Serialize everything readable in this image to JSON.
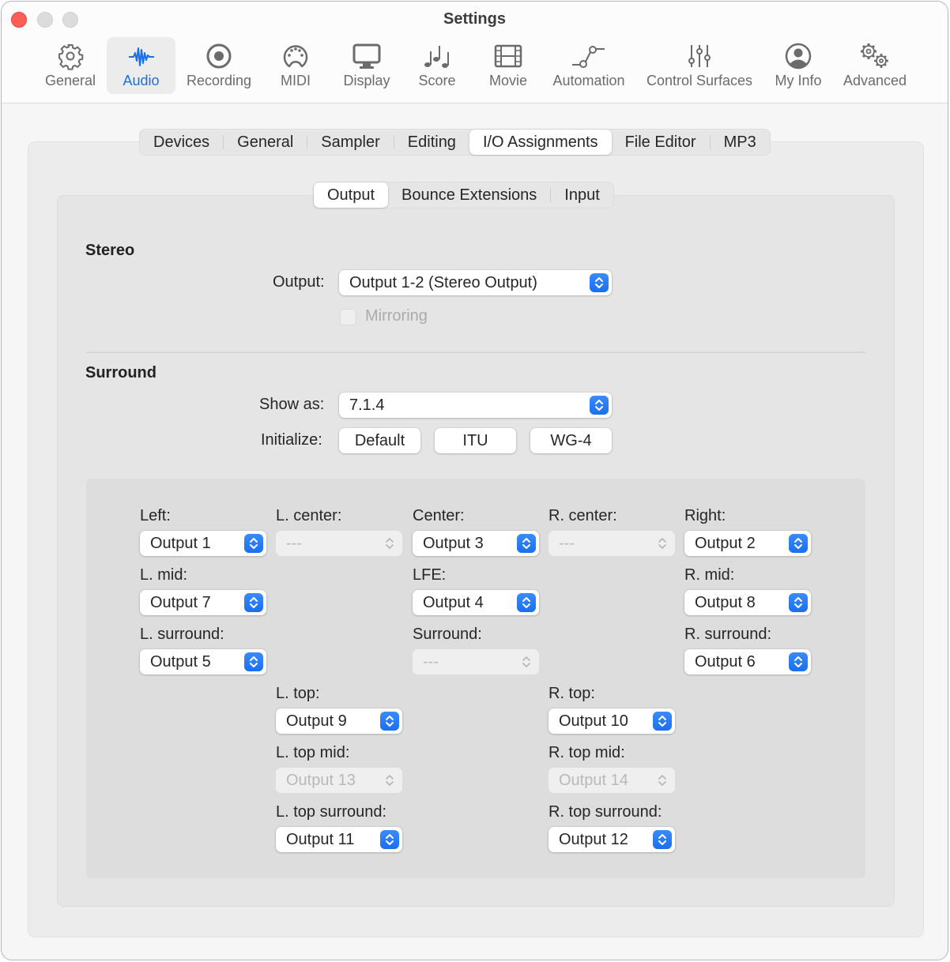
{
  "window": {
    "title": "Settings",
    "traffic_lights": [
      "close",
      "minimize",
      "zoom"
    ]
  },
  "toolbar": {
    "items": [
      {
        "label": "General",
        "icon": "gear-icon",
        "active": false
      },
      {
        "label": "Audio",
        "icon": "waveform-icon",
        "active": true
      },
      {
        "label": "Recording",
        "icon": "record-icon",
        "active": false
      },
      {
        "label": "MIDI",
        "icon": "midi-connector-icon",
        "active": false
      },
      {
        "label": "Display",
        "icon": "monitor-icon",
        "active": false
      },
      {
        "label": "Score",
        "icon": "music-notes-icon",
        "active": false
      },
      {
        "label": "Movie",
        "icon": "film-icon",
        "active": false
      },
      {
        "label": "Automation",
        "icon": "automation-curve-icon",
        "active": false
      },
      {
        "label": "Control Surfaces",
        "icon": "sliders-icon",
        "active": false
      },
      {
        "label": "My Info",
        "icon": "person-circle-icon",
        "active": false
      },
      {
        "label": "Advanced",
        "icon": "gears-icon",
        "active": false
      }
    ],
    "accent_color": "#1a6fe6"
  },
  "tabs": {
    "items": [
      "Devices",
      "General",
      "Sampler",
      "Editing",
      "I/O Assignments",
      "File Editor",
      "MP3"
    ],
    "selected": "I/O Assignments"
  },
  "subtabs": {
    "items": [
      "Output",
      "Bounce Extensions",
      "Input"
    ],
    "selected": "Output"
  },
  "stereo": {
    "title": "Stereo",
    "output_label": "Output:",
    "output_value": "Output 1-2 (Stereo Output)",
    "mirroring_label": "Mirroring",
    "mirroring_checked": false,
    "mirroring_enabled": false
  },
  "surround": {
    "title": "Surround",
    "show_as_label": "Show as:",
    "show_as_value": "7.1.4",
    "initialize_label": "Initialize:",
    "buttons": [
      "Default",
      "ITU",
      "WG-4"
    ],
    "channels": {
      "left": {
        "label": "Left:",
        "value": "Output 1",
        "enabled": true
      },
      "l_center": {
        "label": "L. center:",
        "value": "---",
        "enabled": false
      },
      "center": {
        "label": "Center:",
        "value": "Output 3",
        "enabled": true
      },
      "r_center": {
        "label": "R. center:",
        "value": "---",
        "enabled": false
      },
      "right": {
        "label": "Right:",
        "value": "Output 2",
        "enabled": true
      },
      "l_mid": {
        "label": "L. mid:",
        "value": "Output 7",
        "enabled": true
      },
      "lfe": {
        "label": "LFE:",
        "value": "Output 4",
        "enabled": true
      },
      "r_mid": {
        "label": "R. mid:",
        "value": "Output 8",
        "enabled": true
      },
      "l_surround": {
        "label": "L. surround:",
        "value": "Output 5",
        "enabled": true
      },
      "surround": {
        "label": "Surround:",
        "value": "---",
        "enabled": false
      },
      "r_surround": {
        "label": "R. surround:",
        "value": "Output 6",
        "enabled": true
      },
      "l_top": {
        "label": "L. top:",
        "value": "Output 9",
        "enabled": true
      },
      "r_top": {
        "label": "R. top:",
        "value": "Output 10",
        "enabled": true
      },
      "l_top_mid": {
        "label": "L. top mid:",
        "value": "Output 13",
        "enabled": false
      },
      "r_top_mid": {
        "label": "R. top mid:",
        "value": "Output 14",
        "enabled": false
      },
      "l_top_surround": {
        "label": "L. top surround:",
        "value": "Output 11",
        "enabled": true
      },
      "r_top_surround": {
        "label": "R. top surround:",
        "value": "Output 12",
        "enabled": true
      }
    }
  }
}
